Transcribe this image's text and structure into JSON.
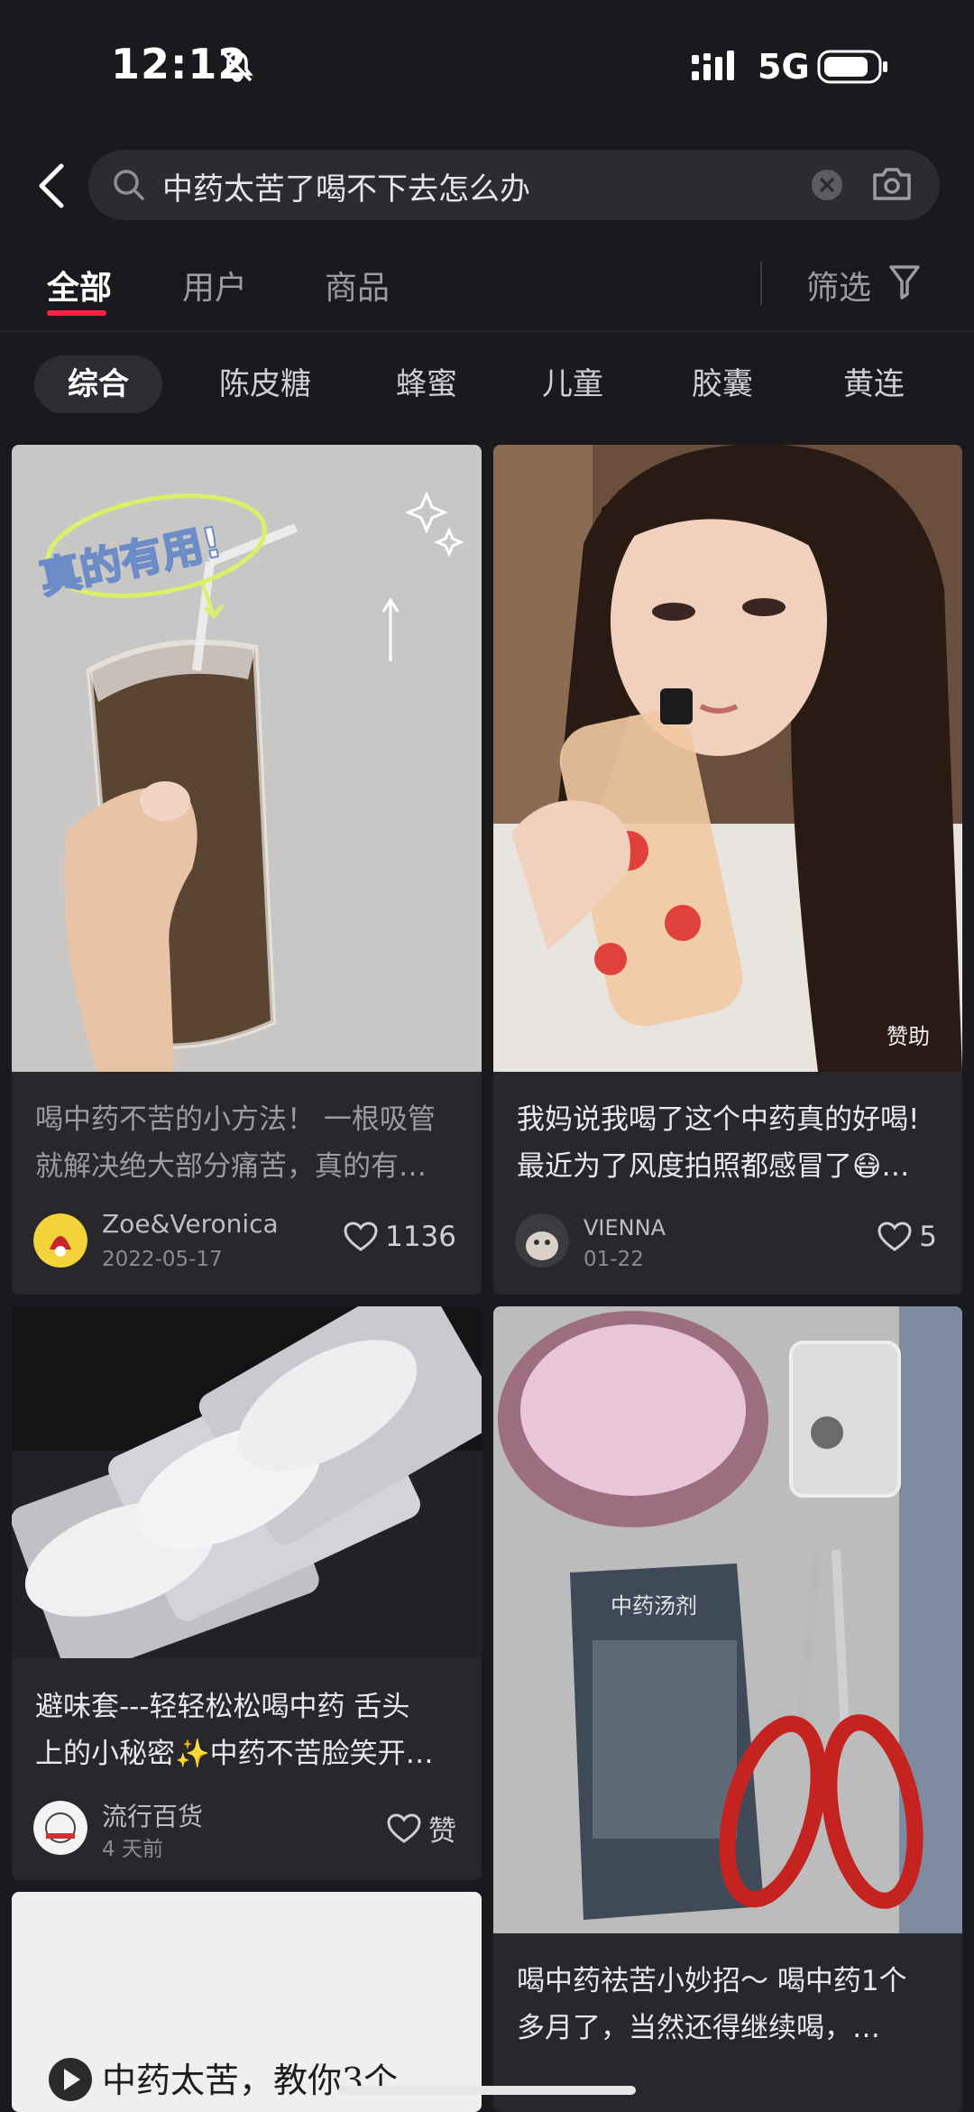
{
  "status_bar": {
    "time": "12:12",
    "network": "5G"
  },
  "search": {
    "query": "中药太苦了喝不下去怎么办"
  },
  "tabs": [
    {
      "label": "全部"
    },
    {
      "label": "用户"
    },
    {
      "label": "商品"
    }
  ],
  "filter_label": "筛选",
  "chips": [
    "综合",
    "陈皮糖",
    "蜂蜜",
    "儿童",
    "胶囊",
    "黄连"
  ],
  "cards": [
    {
      "image_text": "真的有用!",
      "title_line1": "喝中药不苦的小方法！ 一根吸管",
      "title_line2": "就解决绝大部分痛苦，真的有…",
      "author": "Zoe&Veronica",
      "date": "2022-05-17",
      "likes": "1136"
    },
    {
      "badge": "赞助",
      "title_line1": "我妈说我喝了这个中药真的好喝!",
      "title_line2": "最近为了风度拍照都感冒了😷…",
      "author": "VIENNA",
      "date": "01-22",
      "likes": "5"
    },
    {
      "title_line1": "避味套---轻轻松松喝中药 舌头",
      "title_line2": "上的小秘密✨中药不苦脸笑开…",
      "author": "流行百货",
      "date": "4 天前",
      "likes": "赞"
    },
    {
      "package_text": "中药汤剂",
      "title_line1": "喝中药祛苦小妙招～ 喝中药1个",
      "title_line2": "多月了，当然还得继续喝，…"
    },
    {
      "image_text": "中药太苦，教你3个"
    }
  ],
  "colors": {
    "accent": "#ff2442",
    "background": "#19191e",
    "card": "#27272c"
  }
}
